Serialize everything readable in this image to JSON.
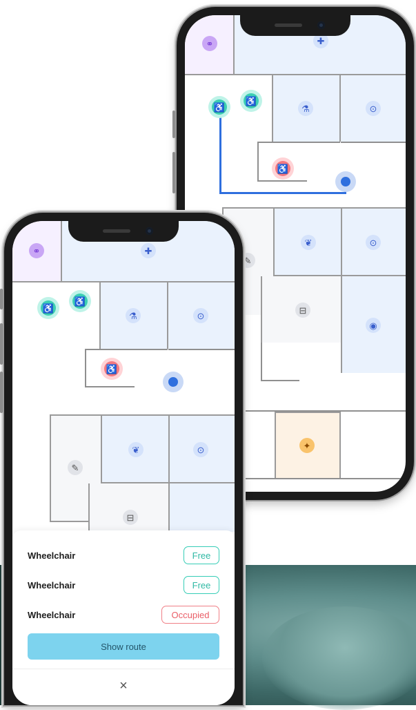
{
  "colors": {
    "route": "#2f6fde",
    "free": "#35cdb6",
    "occupied": "#f07f86",
    "button": "#7dd3ee",
    "room_blue": "#eaf2fd",
    "room_purple": "#f6f0ff",
    "room_orange": "#fdf2e4",
    "room_gray": "#f6f7f9"
  },
  "icons": {
    "restroom": "restroom-icon",
    "reception": "reception-desk-icon",
    "wheelchair_free": "wheelchair-icon",
    "wheelchair_occupied": "wheelchair-icon",
    "location": "current-location-icon",
    "xray": "xray-icon",
    "lab": "lab-icon",
    "scan": "scan-icon",
    "waiting": "waiting-room-icon",
    "dental": "dental-icon",
    "eye": "eye-icon",
    "cafeteria": "cafeteria-icon"
  },
  "sheet": {
    "items": [
      {
        "label": "Wheelchair",
        "status": "Free",
        "state": "free"
      },
      {
        "label": "Wheelchair",
        "status": "Free",
        "state": "free"
      },
      {
        "label": "Wheelchair",
        "status": "Occupied",
        "state": "occupied"
      }
    ],
    "action_label": "Show route",
    "close_symbol": "×"
  }
}
